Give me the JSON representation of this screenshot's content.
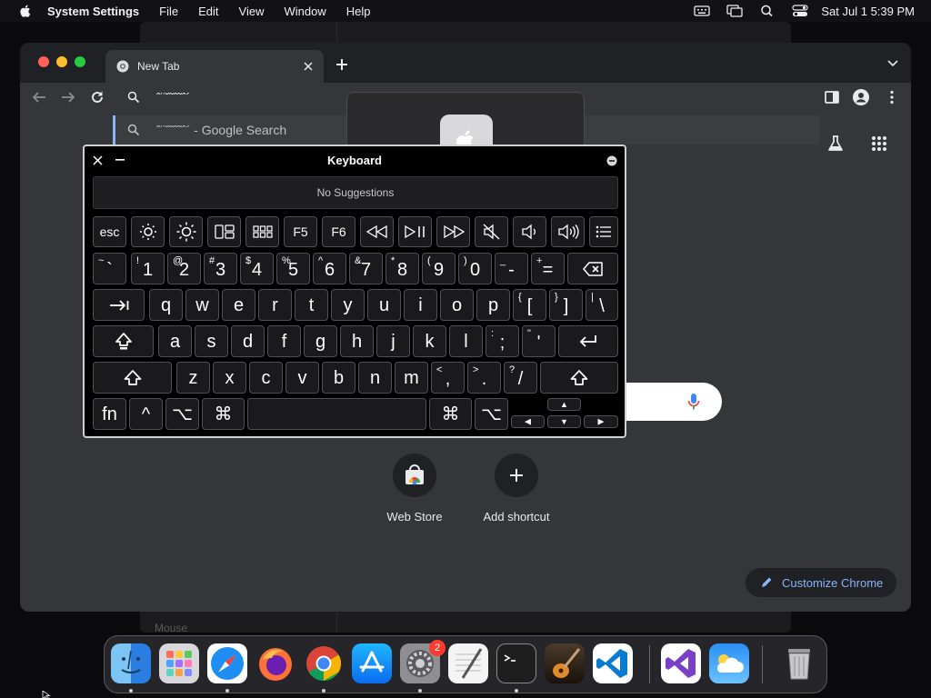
{
  "menubar": {
    "app_name": "System Settings",
    "items": [
      "File",
      "Edit",
      "View",
      "Window",
      "Help"
    ],
    "clock": "Sat Jul 1  5:39 PM"
  },
  "background_window": {
    "sidebar_item": "Mouse"
  },
  "chrome": {
    "tab_title": "New Tab",
    "omnibox": {
      "typed_text": "ˆ¨ˇ˜ˆ˜ˆ´",
      "suggestion_text": "ˆ¨ˇ˜ˆ˜ˆ´ - Google Search"
    },
    "shortcuts": [
      {
        "label": "Web Store"
      },
      {
        "label": "Add shortcut"
      }
    ],
    "customize_label": "Customize Chrome"
  },
  "keyboard_viewer": {
    "title": "Keyboard",
    "suggestions": "No Suggestions",
    "function_row": [
      "esc",
      "",
      "",
      "",
      "",
      "F5",
      "F6",
      "",
      "",
      "",
      "",
      "",
      "",
      ""
    ],
    "number_row": [
      {
        "sup": "~",
        "main": "`"
      },
      {
        "sup": "!",
        "main": "1"
      },
      {
        "sup": "@",
        "main": "2"
      },
      {
        "sup": "#",
        "main": "3"
      },
      {
        "sup": "$",
        "main": "4"
      },
      {
        "sup": "%",
        "main": "5"
      },
      {
        "sup": "^",
        "main": "6"
      },
      {
        "sup": "&",
        "main": "7"
      },
      {
        "sup": "*",
        "main": "8"
      },
      {
        "sup": "(",
        "main": "9"
      },
      {
        "sup": ")",
        "main": "0"
      },
      {
        "sup": "_",
        "main": "-"
      },
      {
        "sup": "+",
        "main": "="
      }
    ],
    "qwerty_row": [
      "q",
      "w",
      "e",
      "r",
      "t",
      "y",
      "u",
      "i",
      "o",
      "p"
    ],
    "qwerty_brackets": [
      {
        "sup": "{",
        "main": "["
      },
      {
        "sup": "}",
        "main": "]"
      },
      {
        "sup": "|",
        "main": "\\"
      }
    ],
    "home_row": [
      "a",
      "s",
      "d",
      "f",
      "g",
      "h",
      "j",
      "k",
      "l"
    ],
    "home_punct": [
      {
        "sup": ":",
        "main": ";"
      },
      {
        "sup": "\"",
        "main": "'"
      }
    ],
    "bottom_row": [
      "z",
      "x",
      "c",
      "v",
      "b",
      "n",
      "m"
    ],
    "bottom_punct": [
      {
        "sup": "<",
        "main": ","
      },
      {
        "sup": ">",
        "main": "."
      },
      {
        "sup": "?",
        "main": "/"
      }
    ],
    "modifiers": {
      "fn": "fn",
      "ctrl": "^",
      "opt": "⌥",
      "cmd": "⌘"
    }
  },
  "dock": {
    "apps": [
      "Finder",
      "Launchpad",
      "Safari",
      "Firefox",
      "Google Chrome",
      "App Store",
      "System Settings",
      "TextEdit",
      "Terminal",
      "GarageBand",
      "Visual Studio Code",
      "Visual Studio",
      "Weather",
      "Trash"
    ],
    "settings_badge": "2"
  }
}
